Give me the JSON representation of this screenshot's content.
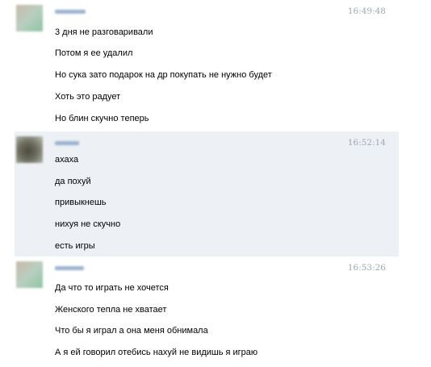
{
  "colors": {
    "highlight_background": "#edf1f5",
    "timestamp": "#9da8b4",
    "blurred_name": "#9bb2ce"
  },
  "messages": [
    {
      "author_blurred": true,
      "avatar_blurred": true,
      "time": "16:49:48",
      "lines": [
        "3 дня не разговаривали",
        "Потом я ее удалил",
        "Но сука зато подарок на др покупать не нужно будет",
        "Хоть это радует",
        "Но блин скучно теперь"
      ]
    },
    {
      "author_blurred": true,
      "avatar_blurred": true,
      "time": "16:52:14",
      "lines": [
        "ахаха",
        "да похуй",
        "привыкнешь",
        "нихуя не скучно",
        "есть игры"
      ]
    },
    {
      "author_blurred": true,
      "avatar_blurred": true,
      "time": "16:53:26",
      "lines": [
        "Да что то играть не хочется",
        "Женского тепла не хватает",
        "Что бы я играл а она меня обнимала",
        "А я ей говорил отебись нахуй не видишь я играю"
      ]
    }
  ]
}
